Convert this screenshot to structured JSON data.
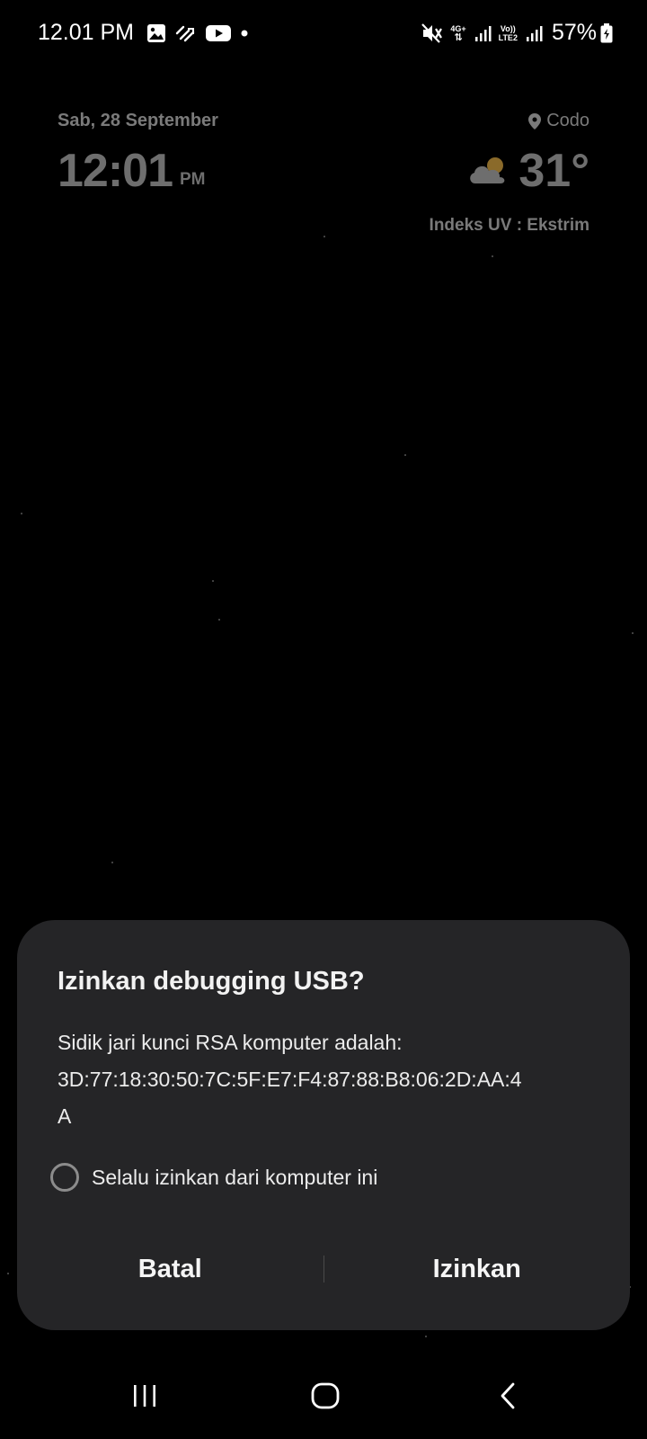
{
  "status_bar": {
    "time": "12.01 PM",
    "left_icons": [
      "gallery-icon",
      "transfer-icon",
      "youtube-icon",
      "dot-icon"
    ],
    "right_icons": [
      "mute-vibrate-icon",
      "network-4g-icon",
      "signal-icon",
      "volte-icon",
      "signal-icon",
      "battery-charging-icon"
    ],
    "network_4g": "4G+",
    "volte_top": "Vo))",
    "volte_bottom": "LTE2",
    "battery": "57%"
  },
  "lock_screen": {
    "date": "Sab, 28 September",
    "time": "12:01",
    "ampm": "PM",
    "location": "Codo",
    "temperature": "31°",
    "uv_index": "Indeks UV : Ekstrim",
    "weather_icon": "partly-cloudy-icon"
  },
  "dialog": {
    "title": "Izinkan debugging USB?",
    "message_line1": "Sidik jari kunci RSA komputer adalah:",
    "message_line2": "3D:77:18:30:50:7C:5F:E7:F4:87:88:B8:06:2D:AA:4",
    "message_line3": "A",
    "checkbox_label": "Selalu izinkan dari komputer ini",
    "checkbox_checked": false,
    "cancel_label": "Batal",
    "allow_label": "Izinkan"
  },
  "nav_bar": {
    "items": [
      "recents-icon",
      "home-icon",
      "back-icon"
    ]
  },
  "colors": {
    "background": "#000000",
    "dialog_bg": "#252527",
    "dim_text": "#7a7a7a",
    "text": "#ffffff"
  }
}
